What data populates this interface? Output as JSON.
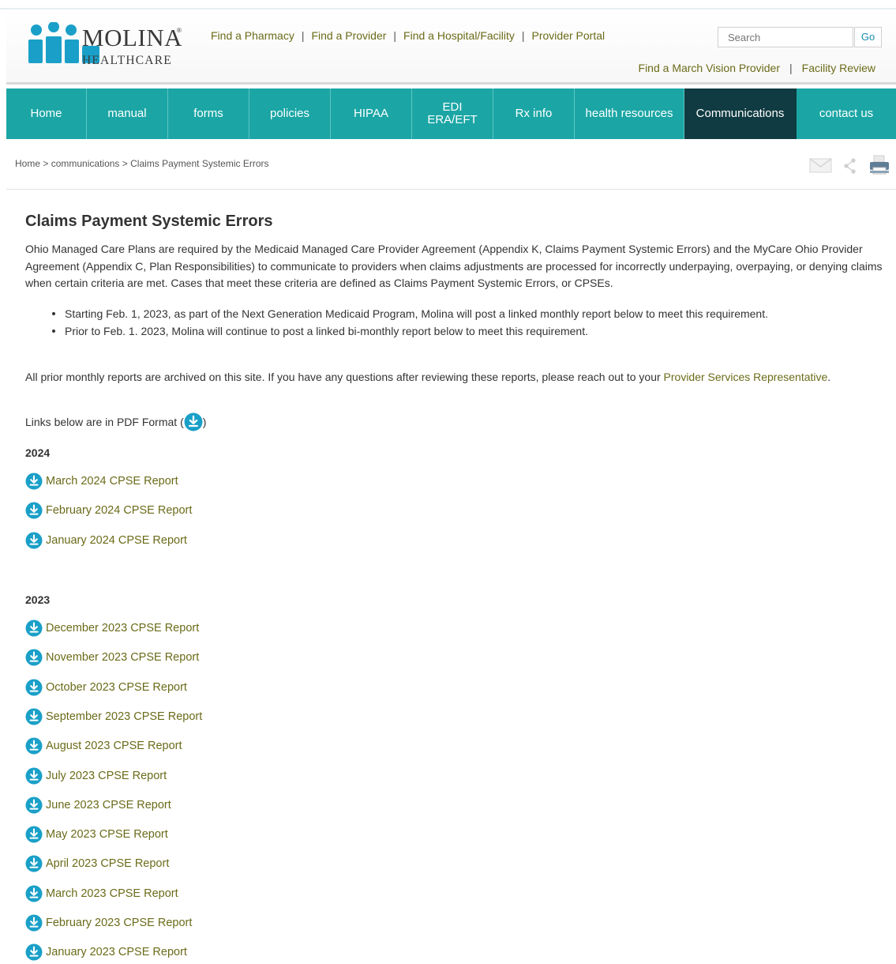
{
  "brand": {
    "name_line1": "MOLINA",
    "name_line2": "HEALTHCARE",
    "reg": "®",
    "colors": {
      "teal": "#1ba6a5",
      "dark": "#103b42",
      "link": "#6b6b1a",
      "icon": "#1aa0c8"
    }
  },
  "header": {
    "links": [
      "Find a Pharmacy",
      "Find a Provider",
      "Find a Hospital/Facility",
      "Provider Portal"
    ],
    "sublinks": [
      "Find a March Vision Provider",
      "Facility Review"
    ],
    "separator": "|",
    "search": {
      "placeholder": "Search",
      "button": "Go"
    }
  },
  "nav": {
    "items": [
      {
        "label": "Home"
      },
      {
        "label": "manual"
      },
      {
        "label": "forms"
      },
      {
        "label": "policies"
      },
      {
        "label": "HIPAA"
      },
      {
        "label_line1": "EDI",
        "label_line2": "ERA/EFT"
      },
      {
        "label": "Rx info"
      },
      {
        "label": "health resources"
      },
      {
        "label": "Communications"
      },
      {
        "label": "contact us"
      }
    ]
  },
  "breadcrumb": {
    "home": "Home",
    "sep": ">",
    "section": "communications",
    "current": "Claims Payment Systemic Errors"
  },
  "tools": [
    "email-icon",
    "share-icon",
    "print-icon"
  ],
  "main": {
    "title": "Claims Payment Systemic Errors",
    "intro": "Ohio Managed Care Plans are required by the Medicaid Managed Care Provider Agreement (Appendix K, Claims Payment Systemic Errors) and the MyCare Ohio Provider Agreement (Appendix C, Plan Responsibilities) to communicate to providers when claims adjustments are processed for incorrectly underpaying, overpaying, or denying claims when certain criteria are met. Cases that meet these criteria are defined as Claims Payment Systemic Errors, or CPSEs.",
    "bullets": [
      "Starting Feb. 1, 2023, as part of the Next Generation Medicaid Program, Molina will post a linked monthly report below to meet this requirement.",
      "Prior to Feb. 1. 2023, Molina will continue to post a linked bi-monthly report below to meet this requirement."
    ],
    "archive_text": "All prior monthly reports are archived on this site. If you have any questions after reviewing these reports, please reach out to your ",
    "archive_link": "Provider Services Representative",
    "archive_end": ".",
    "pdf_note_before": "Links below are in PDF Format (",
    "pdf_note_after": ")",
    "years": [
      {
        "year": "2024",
        "reports": [
          "March 2024 CPSE Report",
          "February 2024 CPSE Report",
          "January 2024 CPSE Report"
        ]
      },
      {
        "year": "2023",
        "reports": [
          "December 2023 CPSE Report",
          "November 2023 CPSE Report",
          "October 2023 CPSE Report",
          "September 2023 CPSE Report",
          "August 2023 CPSE Report",
          "July 2023 CPSE Report",
          "June 2023 CPSE Report",
          "May 2023 CPSE Report",
          "April 2023 CPSE Report",
          "March 2023 CPSE Report",
          "February 2023 CPSE Report",
          "January 2023 CPSE Report"
        ]
      }
    ]
  }
}
